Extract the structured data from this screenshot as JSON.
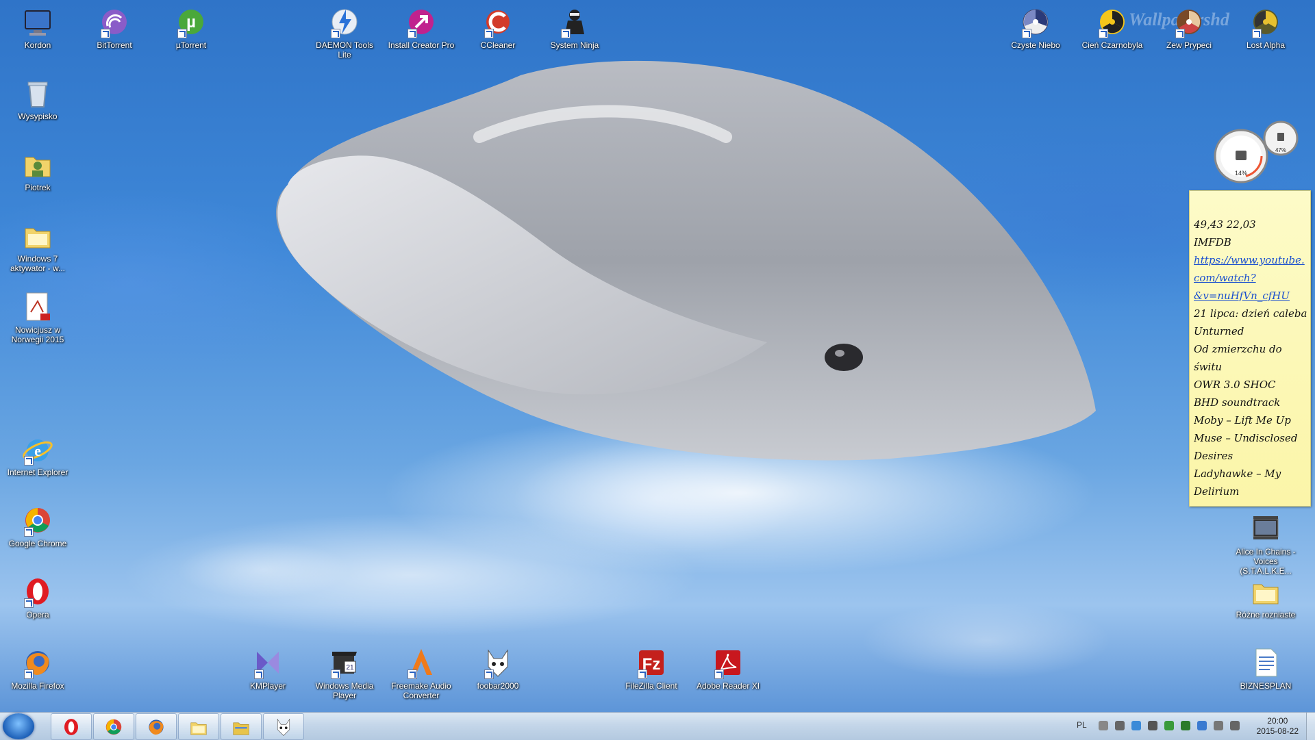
{
  "wallpaper": {
    "watermark": "Wallpapershd"
  },
  "desktop_left": [
    {
      "label": "Kordon",
      "icon": "computer-icon",
      "shortcut": false
    },
    {
      "label": "Wysypisko",
      "icon": "recycle-bin-icon",
      "shortcut": false
    },
    {
      "label": "Piotrek",
      "icon": "user-folder-icon",
      "shortcut": false
    },
    {
      "label": "Windows 7 aktywator - w...",
      "icon": "folder-icon",
      "shortcut": false
    },
    {
      "label": "Nowicjusz w Norwegii 2015",
      "icon": "pdf-document-icon",
      "shortcut": false
    },
    {
      "label": "Internet Explorer",
      "icon": "internet-explorer-icon",
      "shortcut": true
    },
    {
      "label": "Google Chrome",
      "icon": "chrome-icon",
      "shortcut": true
    },
    {
      "label": "Opera",
      "icon": "opera-icon",
      "shortcut": true
    },
    {
      "label": "Mozilla Firefox",
      "icon": "firefox-icon",
      "shortcut": true
    }
  ],
  "desktop_top": [
    {
      "label": "BitTorrent",
      "icon": "bittorrent-icon"
    },
    {
      "label": "µTorrent",
      "icon": "utorrent-icon"
    },
    {
      "label": "DAEMON Tools Lite",
      "icon": "daemon-tools-icon"
    },
    {
      "label": "Install Creator Pro",
      "icon": "install-creator-icon"
    },
    {
      "label": "CCleaner",
      "icon": "ccleaner-icon"
    },
    {
      "label": "System Ninja",
      "icon": "system-ninja-icon"
    }
  ],
  "desktop_top_right": [
    {
      "label": "Czyste Niebo",
      "icon": "czyste-niebo-icon"
    },
    {
      "label": "Cień Czarnobyla",
      "icon": "radiation-icon"
    },
    {
      "label": "Zew Prypeci",
      "icon": "zew-prypeci-icon"
    },
    {
      "label": "Lost Alpha",
      "icon": "lost-alpha-icon"
    }
  ],
  "desktop_right": [
    {
      "label": "Alice In Chains - Voices (S.T.A.L.K.E...",
      "icon": "video-file-icon"
    },
    {
      "label": "Różne rozniaste",
      "icon": "folder-icon"
    },
    {
      "label": "BIZNESPLAN",
      "icon": "document-icon"
    }
  ],
  "desktop_bottom": [
    {
      "label": "KMPlayer",
      "icon": "kmplayer-icon"
    },
    {
      "label": "Windows Media Player",
      "icon": "media-player-icon"
    },
    {
      "label": "Freemake Audio Converter",
      "icon": "freemake-icon"
    },
    {
      "label": "foobar2000",
      "icon": "foobar-icon"
    },
    {
      "label": "FileZilla Client",
      "icon": "filezilla-icon"
    },
    {
      "label": "Adobe Reader XI",
      "icon": "adobe-reader-icon"
    }
  ],
  "gadget": {
    "cpu_percent": "14%",
    "ram_percent": "47%"
  },
  "sticky_note": {
    "lines": [
      {
        "text": "49,43  22,03",
        "link": false
      },
      {
        "text": "IMFDB",
        "link": false
      },
      {
        "text": "https://www.youtube.",
        "link": true
      },
      {
        "text": "com/watch?",
        "link": true
      },
      {
        "text": "&v=nuHfVn_cfHU",
        "link": true
      },
      {
        "text": "21 lipca: dzień caleba",
        "link": false
      },
      {
        "text": "Unturned",
        "link": false
      },
      {
        "text": "Od zmierzchu do",
        "link": false
      },
      {
        "text": "świtu",
        "link": false
      },
      {
        "text": "OWR 3.0 SHOC",
        "link": false
      },
      {
        "text": "BHD soundtrack",
        "link": false
      },
      {
        "text": "Moby – Lift Me Up",
        "link": false
      },
      {
        "text": "Muse – Undisclosed",
        "link": false
      },
      {
        "text": "Desires",
        "link": false
      },
      {
        "text": "Ladyhawke – My",
        "link": false
      },
      {
        "text": "Delirium",
        "link": false
      }
    ]
  },
  "taskbar": {
    "pinned": [
      "opera-icon",
      "chrome-icon",
      "firefox-icon",
      "folder-icon",
      "explorer-icon",
      "foobar-icon"
    ],
    "language": "PL",
    "time": "20:00",
    "date": "2015-08-22"
  }
}
